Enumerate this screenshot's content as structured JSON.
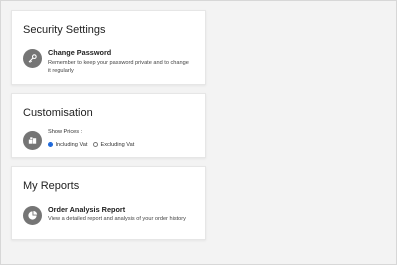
{
  "sections": {
    "security": {
      "title": "Security Settings",
      "item_title": "Change Password",
      "item_desc": "Remember to keep your password private and to change it regularly",
      "icon": "key-icon"
    },
    "customisation": {
      "title": "Customisation",
      "show_prices_label": "Show Prices :",
      "options": [
        {
          "label": "Including Vat",
          "selected": true
        },
        {
          "label": "Excluding Vat",
          "selected": false
        }
      ],
      "icon": "settings-blocks-icon"
    },
    "reports": {
      "title": "My Reports",
      "item_title": "Order Analysis Report",
      "item_desc": "View a detailed report and analysis of your order history",
      "icon": "pie-chart-icon"
    }
  },
  "colors": {
    "page_bg": "#f3f3f3",
    "card_bg": "#ffffff",
    "icon_circle": "#757575",
    "radio_accent": "#1a66d9"
  }
}
